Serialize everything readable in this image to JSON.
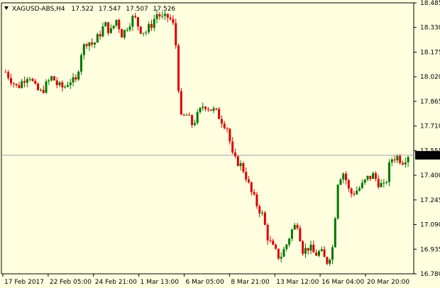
{
  "header": {
    "symbol": "XAGUSD-ABS,H4",
    "open": "17.522",
    "high": "17.547",
    "low": "17.507",
    "close": "17.526"
  },
  "colors": {
    "background": "#FFFFE0",
    "bull_candle": "#007700",
    "bear_candle": "#DD0000",
    "grid_line": "#9AA0A6",
    "price_box": "#000000",
    "price_box_text": "#FFFFE0"
  },
  "chart_data": {
    "type": "candlestick",
    "title": "XAGUSD-ABS,H4",
    "xlabel": "",
    "ylabel": "",
    "ylim": [
      16.78,
      18.485
    ],
    "y_ticks": [
      "18.485",
      "18.330",
      "18.175",
      "18.020",
      "17.865",
      "17.710",
      "17.555",
      "17.400",
      "17.245",
      "17.090",
      "16.935",
      "16.780"
    ],
    "x_ticks": [
      "17 Feb 2017",
      "22 Feb 05:00",
      "24 Feb 21:00",
      "1 Mar 13:00",
      "6 Mar 05:00",
      "8 Mar 21:00",
      "13 Mar 12:00",
      "16 Mar 04:00",
      "20 Mar 20:00"
    ],
    "current_price": "17.526",
    "current_price_value": 17.526,
    "close_path": [
      18.05,
      18.0,
      17.95,
      18.0,
      18.04,
      17.95,
      17.92,
      17.97,
      18.02,
      17.96,
      17.95,
      18.0,
      17.98,
      18.18,
      18.25,
      18.22,
      18.28,
      18.35,
      18.3,
      18.38,
      18.28,
      18.35,
      18.4,
      18.32,
      18.3,
      18.35,
      18.42,
      18.38,
      18.4,
      18.32,
      17.75,
      17.78,
      17.72,
      17.78,
      17.85,
      17.82,
      17.8,
      17.75,
      17.7,
      17.5,
      17.48,
      17.42,
      17.3,
      17.22,
      17.15,
      17.0,
      16.93,
      16.88,
      16.95,
      17.05,
      17.1,
      16.92,
      16.95,
      16.9,
      16.92,
      16.85,
      16.93,
      17.38,
      17.42,
      17.28,
      17.3,
      17.33,
      17.38,
      17.4,
      17.35,
      17.32,
      17.5,
      17.52,
      17.49,
      17.53
    ]
  }
}
